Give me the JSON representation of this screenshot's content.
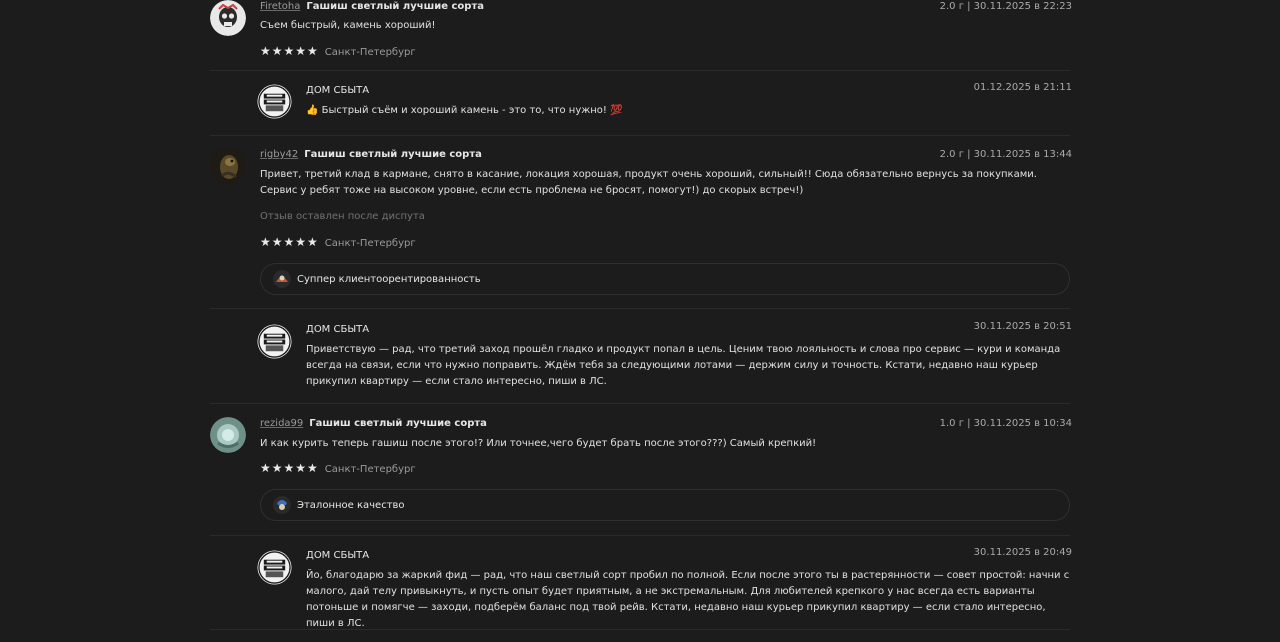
{
  "reviews": [
    {
      "username": "Firetoha",
      "product": "Гашиш светлый лучшие сорта",
      "meta": "2.0 г | 30.11.2025 в 22:23",
      "text": "Съем быстрый, камень хороший!",
      "stars": "★★★★★",
      "rating": 5,
      "city": "Санкт-Петербург",
      "reply": {
        "shop": "ДОМ СБЫТА",
        "date": "01.12.2025 в 21:11",
        "text": "👍 Быстрый съём и хороший камень - это то, что нужно! 💯"
      }
    },
    {
      "username": "rigby42",
      "product": "Гашиш светлый лучшие сорта",
      "meta": "2.0 г | 30.11.2025 в 13:44",
      "text": "Привет, третий клад в кармане, снято в касание, локация хорошая, продукт очень хороший, сильный!! Сюда обязательно вернусь за покупками. Сервис у ребят тоже на высоком уровне, если есть проблема не бросят, помогут!) до скорых встреч!)",
      "note": "Отзыв оставлен после диспута",
      "stars": "★★★★★",
      "rating": 5,
      "city": "Санкт-Петербург",
      "badge": "Суппер клиентоорентированность",
      "reply": {
        "shop": "ДОМ СБЫТА",
        "date": "30.11.2025 в 20:51",
        "text": "Приветствую — рад, что третий заход прошёл гладко и продукт попал в цель. Ценим твою лояльность и слова про сервис — кури и команда всегда на связи, если что нужно поправить. Ждём тебя за следующими лотами — держим силу и точность. Кстати, недавно наш курьер прикупил квартиру — если стало интересно, пиши в ЛС."
      }
    },
    {
      "username": "rezida99",
      "product": "Гашиш светлый лучшие сорта",
      "meta": "1.0 г | 30.11.2025 в 10:34",
      "text": "И как курить теперь гашиш после этого!? Или точнее,чего будет брать после этого???) Самый крепкий!",
      "stars": "★★★★★",
      "rating": 5,
      "city": "Санкт-Петербург",
      "badge": "Эталонное качество",
      "reply": {
        "shop": "ДОМ СБЫТА",
        "date": "30.11.2025 в 20:49",
        "text": "Йо, благодарю за жаркий фид — рад, что наш светлый сорт пробил по полной. Если после этого ты в растерянности — совет простой: начни с малого, дай телу привыкнуть, и пусть опыт будет приятным, а не экстремальным. Для любителей крепкого у нас всегда есть варианты потоньше и помягче — заходи, подберём баланс под твой рейв. Кстати, недавно наш курьер прикупил квартиру — если стало интересно, пиши в ЛС."
      }
    }
  ],
  "colors": {
    "background": "#1c1c1c",
    "separator": "#2a2a2a",
    "text": "#e0e0e0",
    "muted": "#9a9a9a"
  },
  "icons": {
    "review_avatar_1": "skull-avatar-icon",
    "review_avatar_2": "dark-creature-avatar-icon",
    "review_avatar_3": "teal-avatar-icon",
    "shop_avatar": "dom-sbyta-logo-icon",
    "badge_1": "service-badge-icon",
    "badge_2": "quality-badge-icon"
  }
}
